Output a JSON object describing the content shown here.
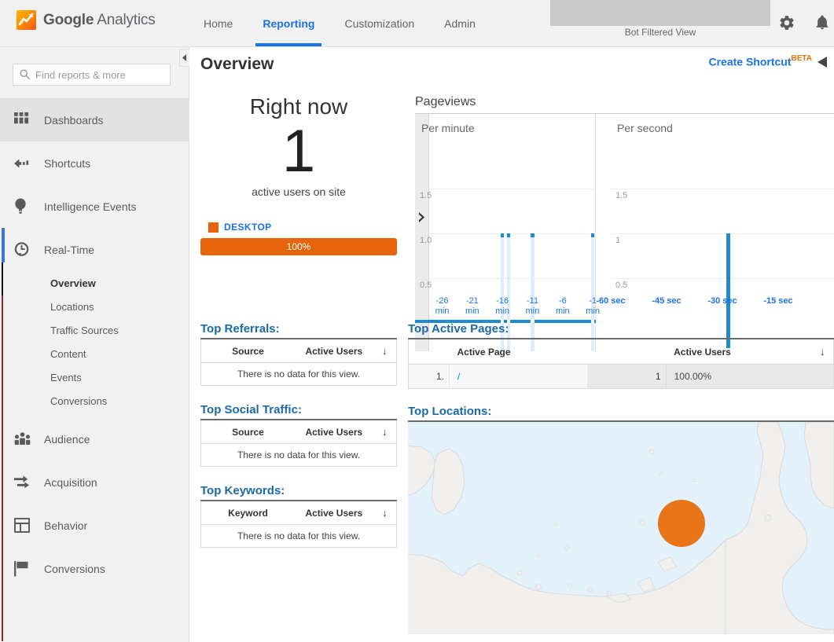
{
  "topbar": {
    "brand_bold": "Google",
    "brand_light": " Analytics",
    "logo_icon": "google-analytics-logo-icon",
    "nav": [
      {
        "label": "Home",
        "active": false
      },
      {
        "label": "Reporting",
        "active": true
      },
      {
        "label": "Customization",
        "active": false
      },
      {
        "label": "Admin",
        "active": false
      }
    ],
    "account_label": "Bot Filtered View",
    "gear_icon": "gear-icon",
    "bell_icon": "bell-icon"
  },
  "sidebar": {
    "search_placeholder": "Find reports & more",
    "search_value": "",
    "search_icon": "search-icon",
    "collapse_icon": "chevron-left-icon",
    "items": [
      {
        "label": "Dashboards",
        "icon": "dashboards-grid-icon",
        "highlight": true
      },
      {
        "label": "Shortcuts",
        "icon": "shortcuts-arrow-icon",
        "highlight": false
      },
      {
        "label": "Intelligence Events",
        "icon": "lightbulb-icon",
        "highlight": false
      },
      {
        "label": "Real-Time",
        "icon": "clock-icon",
        "highlight": false
      }
    ],
    "realtime_sub": [
      {
        "label": "Overview",
        "current": true
      },
      {
        "label": "Locations",
        "current": false
      },
      {
        "label": "Traffic Sources",
        "current": false
      },
      {
        "label": "Content",
        "current": false
      },
      {
        "label": "Events",
        "current": false
      },
      {
        "label": "Conversions",
        "current": false
      }
    ],
    "items_bottom": [
      {
        "label": "Audience",
        "icon": "people-icon"
      },
      {
        "label": "Acquisition",
        "icon": "arrows-icon"
      },
      {
        "label": "Behavior",
        "icon": "layout-icon"
      },
      {
        "label": "Conversions",
        "icon": "flag-icon"
      }
    ]
  },
  "page": {
    "title": "Overview",
    "create_shortcut": "Create Shortcut",
    "beta_tag": "BETA",
    "collapse_right_icon": "triangle-left-icon"
  },
  "rightnow": {
    "title": "Right now",
    "count": "1",
    "subtitle": "active users on site",
    "device_label": "DESKTOP",
    "device_pct": "100%",
    "accent_color": "#e8640c"
  },
  "pageviews": {
    "title": "Pageviews",
    "minute_label": "Per minute",
    "second_label": "Per second",
    "expand_icon": "chevron-right-icon"
  },
  "top_referrals": {
    "title": "Top Referrals:",
    "columns": [
      "Source",
      "Active Users"
    ],
    "sort_icon": "sort-desc-arrow-icon",
    "empty_message": "There is no data for this view."
  },
  "top_social": {
    "title": "Top Social Traffic:",
    "columns": [
      "Source",
      "Active Users"
    ],
    "sort_icon": "sort-desc-arrow-icon",
    "empty_message": "There is no data for this view."
  },
  "top_keywords": {
    "title": "Top Keywords:",
    "columns": [
      "Keyword",
      "Active Users"
    ],
    "sort_icon": "sort-desc-arrow-icon",
    "empty_message": "There is no data for this view."
  },
  "top_active_pages": {
    "title": "Top Active Pages:",
    "columns": [
      "Active Page",
      "Active Users"
    ],
    "sort_icon": "sort-desc-arrow-icon",
    "rows": [
      {
        "index": "1.",
        "page": "/",
        "users": "1",
        "percent": "100.00%"
      }
    ]
  },
  "top_locations": {
    "title": "Top Locations:",
    "marker_color": "#e8751a",
    "water_color": "#e3f1fb",
    "land_color": "#f0efed"
  },
  "chart_data": [
    {
      "type": "bar",
      "title": "Pageviews Per minute",
      "xlabel": "",
      "ylabel": "",
      "ylim": [
        0,
        2
      ],
      "yticks": [
        0.5,
        1.0,
        1.5
      ],
      "ytick_labels": [
        "0.5",
        "1.0",
        "1.5"
      ],
      "xticks": [
        -26,
        -21,
        -16,
        -11,
        -6,
        -1
      ],
      "xtick_labels": [
        "-26 min",
        "-21 min",
        "-16 min",
        "-11 min",
        "-6 min",
        "-1 min"
      ],
      "x": [
        -30,
        -29,
        -28,
        -27,
        -26,
        -25,
        -24,
        -23,
        -22,
        -21,
        -20,
        -19,
        -18,
        -17,
        -16,
        -15,
        -14,
        -13,
        -12,
        -11,
        -10,
        -9,
        -8,
        -7,
        -6,
        -5,
        -4,
        -3,
        -2,
        -1
      ],
      "values": [
        0,
        0,
        0,
        0,
        0,
        0,
        0,
        0,
        0,
        0,
        0,
        0,
        0,
        0,
        1,
        1,
        0,
        0,
        0,
        1,
        0,
        0,
        0,
        0,
        0,
        0,
        0,
        0,
        0,
        1
      ],
      "bar_color": "#1f8bcc",
      "grid": true,
      "legend": "none"
    },
    {
      "type": "bar",
      "title": "Pageviews Per second",
      "xlabel": "",
      "ylabel": "",
      "ylim": [
        0,
        2
      ],
      "yticks": [
        0.5,
        1.0,
        1.5
      ],
      "ytick_labels": [
        "0.5",
        "1",
        "1.5"
      ],
      "xticks": [
        -60,
        -45,
        -30,
        -15
      ],
      "xtick_labels": [
        "-60 sec",
        "-45 sec",
        "-30 sec",
        "-15 sec"
      ],
      "highlight_x": -29,
      "highlight_value": 1,
      "bar_color": "#1f8bcc",
      "grid": true,
      "legend": "none"
    }
  ]
}
